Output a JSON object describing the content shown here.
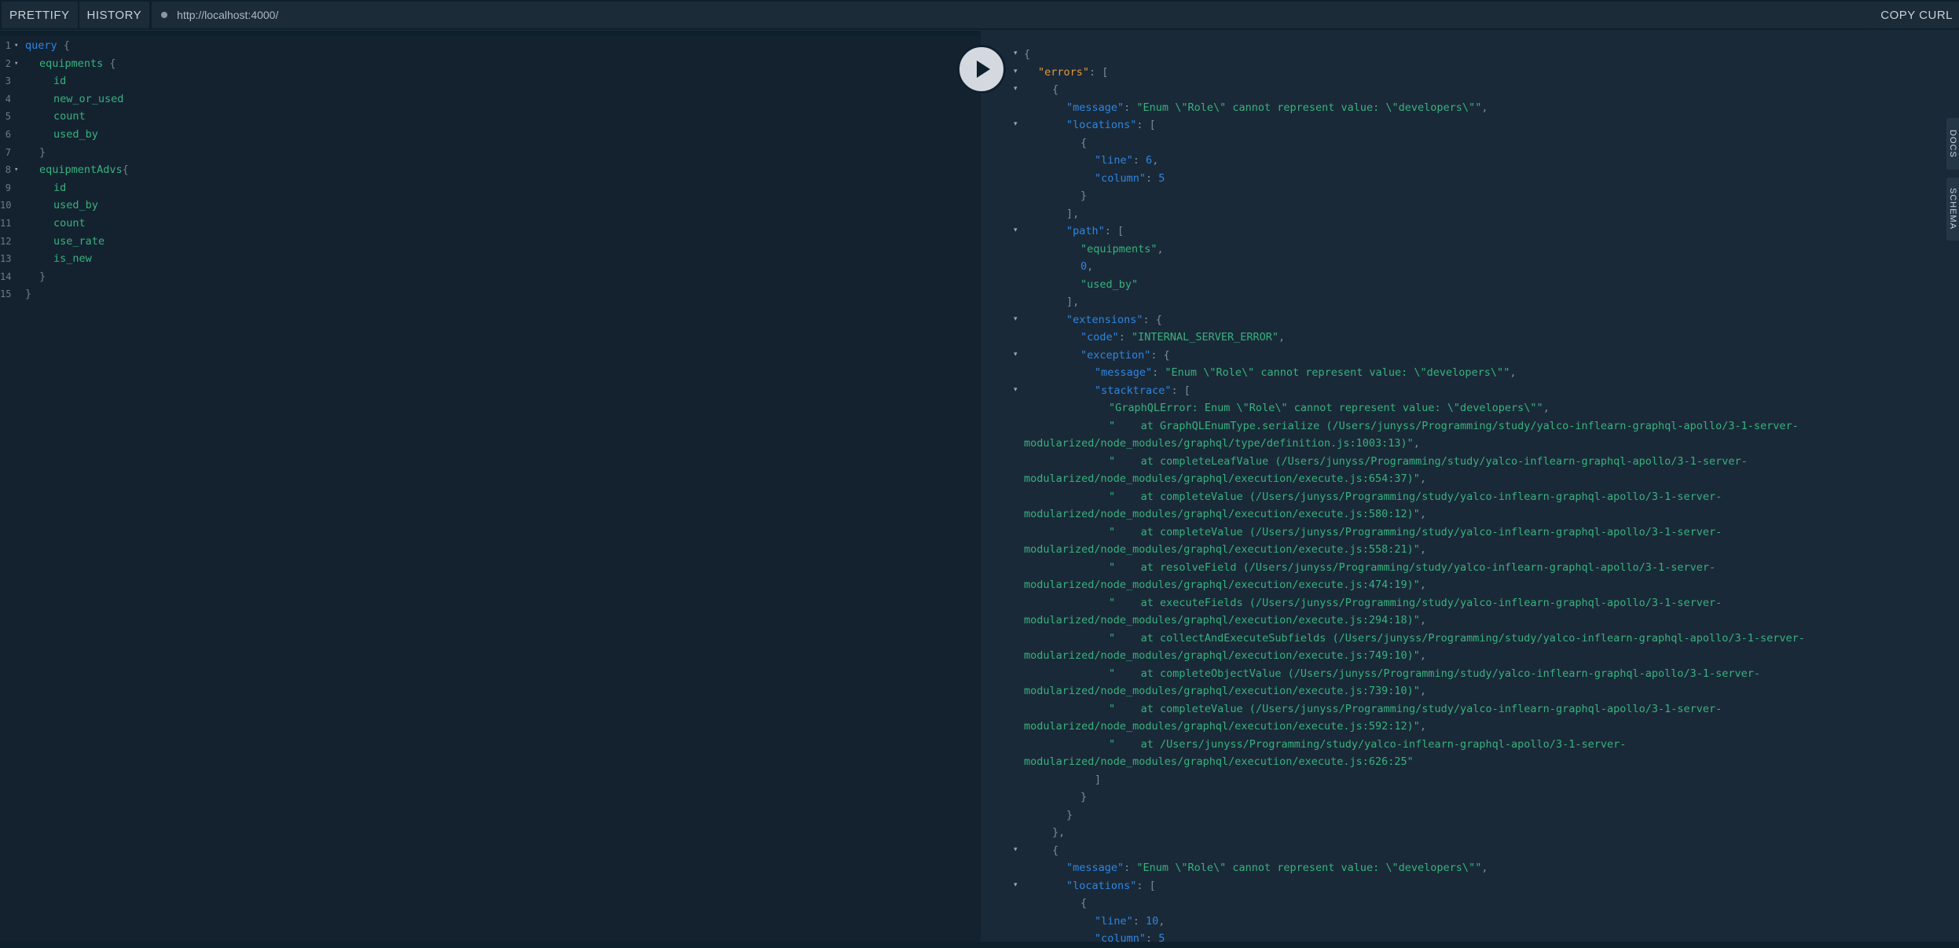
{
  "toolbar": {
    "prettify": "PRETTIFY",
    "history": "HISTORY",
    "url": "http://localhost:4000/",
    "copy_curl": "COPY CURL"
  },
  "side_tabs": {
    "docs": "DOCS",
    "schema": "SCHEMA"
  },
  "query_lines": [
    {
      "n": "1",
      "fold": true,
      "ind": 0,
      "tokens": [
        [
          "kw",
          "query"
        ],
        [
          "pun",
          " {"
        ]
      ]
    },
    {
      "n": "2",
      "fold": true,
      "ind": 1,
      "tokens": [
        [
          "fld",
          "equipments"
        ],
        [
          "pun",
          " {"
        ]
      ]
    },
    {
      "n": "3",
      "fold": false,
      "ind": 2,
      "tokens": [
        [
          "fld",
          "id"
        ]
      ]
    },
    {
      "n": "4",
      "fold": false,
      "ind": 2,
      "tokens": [
        [
          "fld",
          "new_or_used"
        ]
      ]
    },
    {
      "n": "5",
      "fold": false,
      "ind": 2,
      "tokens": [
        [
          "fld",
          "count"
        ]
      ]
    },
    {
      "n": "6",
      "fold": false,
      "ind": 2,
      "tokens": [
        [
          "fld",
          "used_by"
        ]
      ]
    },
    {
      "n": "7",
      "fold": false,
      "ind": 1,
      "tokens": [
        [
          "pun",
          "}"
        ]
      ]
    },
    {
      "n": "8",
      "fold": true,
      "ind": 1,
      "tokens": [
        [
          "fld",
          "equipmentAdvs"
        ],
        [
          "pun",
          "{"
        ]
      ]
    },
    {
      "n": "9",
      "fold": false,
      "ind": 2,
      "tokens": [
        [
          "fld",
          "id"
        ]
      ]
    },
    {
      "n": "10",
      "fold": false,
      "ind": 2,
      "tokens": [
        [
          "fld",
          "used_by"
        ]
      ]
    },
    {
      "n": "11",
      "fold": false,
      "ind": 2,
      "tokens": [
        [
          "fld",
          "count"
        ]
      ]
    },
    {
      "n": "12",
      "fold": false,
      "ind": 2,
      "tokens": [
        [
          "fld",
          "use_rate"
        ]
      ]
    },
    {
      "n": "13",
      "fold": false,
      "ind": 2,
      "tokens": [
        [
          "fld",
          "is_new"
        ]
      ]
    },
    {
      "n": "14",
      "fold": false,
      "ind": 1,
      "tokens": [
        [
          "pun",
          "}"
        ]
      ]
    },
    {
      "n": "15",
      "fold": false,
      "ind": 0,
      "tokens": [
        [
          "pun",
          "}"
        ]
      ]
    }
  ],
  "result_lines": [
    {
      "fold": true,
      "ind": 0,
      "tokens": [
        [
          "pu",
          "{"
        ]
      ]
    },
    {
      "fold": true,
      "ind": 1,
      "tokens": [
        [
          "errkey",
          "\"errors\""
        ],
        [
          "pu",
          ": ["
        ]
      ]
    },
    {
      "fold": true,
      "ind": 2,
      "tokens": [
        [
          "pu",
          "{"
        ]
      ]
    },
    {
      "fold": false,
      "ind": 3,
      "tokens": [
        [
          "key",
          "\"message\""
        ],
        [
          "pu",
          ": "
        ],
        [
          "str",
          "\"Enum \\\"Role\\\" cannot represent value: \\\"developers\\\"\""
        ],
        [
          "pu",
          ","
        ]
      ]
    },
    {
      "fold": true,
      "ind": 3,
      "tokens": [
        [
          "key",
          "\"locations\""
        ],
        [
          "pu",
          ": ["
        ]
      ]
    },
    {
      "fold": false,
      "ind": 4,
      "tokens": [
        [
          "pu",
          "{"
        ]
      ]
    },
    {
      "fold": false,
      "ind": 5,
      "tokens": [
        [
          "key",
          "\"line\""
        ],
        [
          "pu",
          ": "
        ],
        [
          "num",
          "6"
        ],
        [
          "pu",
          ","
        ]
      ]
    },
    {
      "fold": false,
      "ind": 5,
      "tokens": [
        [
          "key",
          "\"column\""
        ],
        [
          "pu",
          ": "
        ],
        [
          "num",
          "5"
        ]
      ]
    },
    {
      "fold": false,
      "ind": 4,
      "tokens": [
        [
          "pu",
          "}"
        ]
      ]
    },
    {
      "fold": false,
      "ind": 3,
      "tokens": [
        [
          "pu",
          "],"
        ]
      ]
    },
    {
      "fold": true,
      "ind": 3,
      "tokens": [
        [
          "key",
          "\"path\""
        ],
        [
          "pu",
          ": ["
        ]
      ]
    },
    {
      "fold": false,
      "ind": 4,
      "tokens": [
        [
          "str",
          "\"equipments\""
        ],
        [
          "pu",
          ","
        ]
      ]
    },
    {
      "fold": false,
      "ind": 4,
      "tokens": [
        [
          "num",
          "0"
        ],
        [
          "pu",
          ","
        ]
      ]
    },
    {
      "fold": false,
      "ind": 4,
      "tokens": [
        [
          "str",
          "\"used_by\""
        ]
      ]
    },
    {
      "fold": false,
      "ind": 3,
      "tokens": [
        [
          "pu",
          "],"
        ]
      ]
    },
    {
      "fold": true,
      "ind": 3,
      "tokens": [
        [
          "key",
          "\"extensions\""
        ],
        [
          "pu",
          ": {"
        ]
      ]
    },
    {
      "fold": false,
      "ind": 4,
      "tokens": [
        [
          "key",
          "\"code\""
        ],
        [
          "pu",
          ": "
        ],
        [
          "str",
          "\"INTERNAL_SERVER_ERROR\""
        ],
        [
          "pu",
          ","
        ]
      ]
    },
    {
      "fold": true,
      "ind": 4,
      "tokens": [
        [
          "key",
          "\"exception\""
        ],
        [
          "pu",
          ": {"
        ]
      ]
    },
    {
      "fold": false,
      "ind": 5,
      "tokens": [
        [
          "key",
          "\"message\""
        ],
        [
          "pu",
          ": "
        ],
        [
          "str",
          "\"Enum \\\"Role\\\" cannot represent value: \\\"developers\\\"\""
        ],
        [
          "pu",
          ","
        ]
      ]
    },
    {
      "fold": true,
      "ind": 5,
      "tokens": [
        [
          "key",
          "\"stacktrace\""
        ],
        [
          "pu",
          ": ["
        ]
      ]
    },
    {
      "fold": false,
      "ind": 6,
      "tokens": [
        [
          "str",
          "\"GraphQLError: Enum \\\"Role\\\" cannot represent value: \\\"developers\\\"\""
        ],
        [
          "pu",
          ","
        ]
      ]
    },
    {
      "fold": false,
      "ind": 6,
      "tokens": [
        [
          "str",
          "\"    at GraphQLEnumType.serialize (/Users/junyss/Programming/study/yalco-inflearn-graphql-apollo/3-1-server-"
        ]
      ]
    },
    {
      "fold": false,
      "ind": 0,
      "tokens": [
        [
          "str",
          "modularized/node_modules/graphql/type/definition.js:1003:13)\""
        ],
        [
          "pu",
          ","
        ]
      ]
    },
    {
      "fold": false,
      "ind": 6,
      "tokens": [
        [
          "str",
          "\"    at completeLeafValue (/Users/junyss/Programming/study/yalco-inflearn-graphql-apollo/3-1-server-"
        ]
      ]
    },
    {
      "fold": false,
      "ind": 0,
      "tokens": [
        [
          "str",
          "modularized/node_modules/graphql/execution/execute.js:654:37)\""
        ],
        [
          "pu",
          ","
        ]
      ]
    },
    {
      "fold": false,
      "ind": 6,
      "tokens": [
        [
          "str",
          "\"    at completeValue (/Users/junyss/Programming/study/yalco-inflearn-graphql-apollo/3-1-server-"
        ]
      ]
    },
    {
      "fold": false,
      "ind": 0,
      "tokens": [
        [
          "str",
          "modularized/node_modules/graphql/execution/execute.js:580:12)\""
        ],
        [
          "pu",
          ","
        ]
      ]
    },
    {
      "fold": false,
      "ind": 6,
      "tokens": [
        [
          "str",
          "\"    at completeValue (/Users/junyss/Programming/study/yalco-inflearn-graphql-apollo/3-1-server-"
        ]
      ]
    },
    {
      "fold": false,
      "ind": 0,
      "tokens": [
        [
          "str",
          "modularized/node_modules/graphql/execution/execute.js:558:21)\""
        ],
        [
          "pu",
          ","
        ]
      ]
    },
    {
      "fold": false,
      "ind": 6,
      "tokens": [
        [
          "str",
          "\"    at resolveField (/Users/junyss/Programming/study/yalco-inflearn-graphql-apollo/3-1-server-"
        ]
      ]
    },
    {
      "fold": false,
      "ind": 0,
      "tokens": [
        [
          "str",
          "modularized/node_modules/graphql/execution/execute.js:474:19)\""
        ],
        [
          "pu",
          ","
        ]
      ]
    },
    {
      "fold": false,
      "ind": 6,
      "tokens": [
        [
          "str",
          "\"    at executeFields (/Users/junyss/Programming/study/yalco-inflearn-graphql-apollo/3-1-server-"
        ]
      ]
    },
    {
      "fold": false,
      "ind": 0,
      "tokens": [
        [
          "str",
          "modularized/node_modules/graphql/execution/execute.js:294:18)\""
        ],
        [
          "pu",
          ","
        ]
      ]
    },
    {
      "fold": false,
      "ind": 6,
      "tokens": [
        [
          "str",
          "\"    at collectAndExecuteSubfields (/Users/junyss/Programming/study/yalco-inflearn-graphql-apollo/3-1-server-"
        ]
      ]
    },
    {
      "fold": false,
      "ind": 0,
      "tokens": [
        [
          "str",
          "modularized/node_modules/graphql/execution/execute.js:749:10)\""
        ],
        [
          "pu",
          ","
        ]
      ]
    },
    {
      "fold": false,
      "ind": 6,
      "tokens": [
        [
          "str",
          "\"    at completeObjectValue (/Users/junyss/Programming/study/yalco-inflearn-graphql-apollo/3-1-server-"
        ]
      ]
    },
    {
      "fold": false,
      "ind": 0,
      "tokens": [
        [
          "str",
          "modularized/node_modules/graphql/execution/execute.js:739:10)\""
        ],
        [
          "pu",
          ","
        ]
      ]
    },
    {
      "fold": false,
      "ind": 6,
      "tokens": [
        [
          "str",
          "\"    at completeValue (/Users/junyss/Programming/study/yalco-inflearn-graphql-apollo/3-1-server-"
        ]
      ]
    },
    {
      "fold": false,
      "ind": 0,
      "tokens": [
        [
          "str",
          "modularized/node_modules/graphql/execution/execute.js:592:12)\""
        ],
        [
          "pu",
          ","
        ]
      ]
    },
    {
      "fold": false,
      "ind": 6,
      "tokens": [
        [
          "str",
          "\"    at /Users/junyss/Programming/study/yalco-inflearn-graphql-apollo/3-1-server-"
        ]
      ]
    },
    {
      "fold": false,
      "ind": 0,
      "tokens": [
        [
          "str",
          "modularized/node_modules/graphql/execution/execute.js:626:25\""
        ]
      ]
    },
    {
      "fold": false,
      "ind": 5,
      "tokens": [
        [
          "pu",
          "]"
        ]
      ]
    },
    {
      "fold": false,
      "ind": 4,
      "tokens": [
        [
          "pu",
          "}"
        ]
      ]
    },
    {
      "fold": false,
      "ind": 3,
      "tokens": [
        [
          "pu",
          "}"
        ]
      ]
    },
    {
      "fold": false,
      "ind": 2,
      "tokens": [
        [
          "pu",
          "},"
        ]
      ]
    },
    {
      "fold": true,
      "ind": 2,
      "tokens": [
        [
          "pu",
          "{"
        ]
      ]
    },
    {
      "fold": false,
      "ind": 3,
      "tokens": [
        [
          "key",
          "\"message\""
        ],
        [
          "pu",
          ": "
        ],
        [
          "str",
          "\"Enum \\\"Role\\\" cannot represent value: \\\"developers\\\"\""
        ],
        [
          "pu",
          ","
        ]
      ]
    },
    {
      "fold": true,
      "ind": 3,
      "tokens": [
        [
          "key",
          "\"locations\""
        ],
        [
          "pu",
          ": ["
        ]
      ]
    },
    {
      "fold": false,
      "ind": 4,
      "tokens": [
        [
          "pu",
          "{"
        ]
      ]
    },
    {
      "fold": false,
      "ind": 5,
      "tokens": [
        [
          "key",
          "\"line\""
        ],
        [
          "pu",
          ": "
        ],
        [
          "num",
          "10"
        ],
        [
          "pu",
          ","
        ]
      ]
    },
    {
      "fold": false,
      "ind": 5,
      "tokens": [
        [
          "key",
          "\"column\""
        ],
        [
          "pu",
          ": "
        ],
        [
          "num",
          "5"
        ]
      ]
    }
  ]
}
